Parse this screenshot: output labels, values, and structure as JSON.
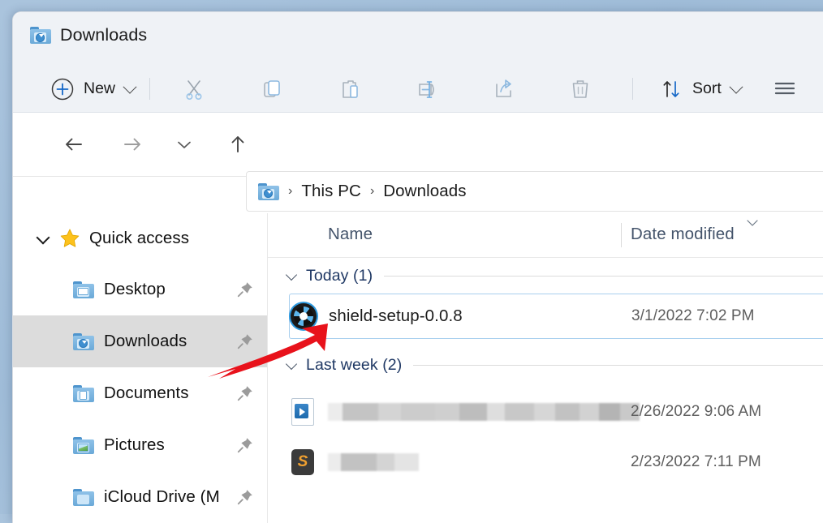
{
  "window": {
    "title": "Downloads",
    "title_icon": "downloads-folder-icon"
  },
  "toolbar": {
    "new_label": "New",
    "new_icon": "plus-circle-icon",
    "cut_icon": "scissors-icon",
    "copy_icon": "copy-icon",
    "paste_icon": "paste-icon",
    "rename_icon": "rename-icon",
    "share_icon": "share-icon",
    "delete_icon": "trash-icon",
    "sort_label": "Sort",
    "sort_icon": "sort-arrows-icon",
    "view_icon": "hamburger-menu-icon"
  },
  "nav": {
    "back_icon": "arrow-left-icon",
    "forward_icon": "arrow-right-icon",
    "recent_icon": "chevron-down-icon",
    "up_icon": "arrow-up-icon",
    "breadcrumb": {
      "icon": "downloads-folder-icon",
      "separator": "›",
      "items": [
        "This PC",
        "Downloads"
      ]
    }
  },
  "sidebar": {
    "items": [
      {
        "label": "Quick access",
        "icon": "star-icon",
        "type": "group",
        "expanded": true,
        "pinned": false,
        "selected": false
      },
      {
        "label": "Desktop",
        "icon": "desktop-folder-icon",
        "type": "item",
        "pinned": true,
        "selected": false
      },
      {
        "label": "Downloads",
        "icon": "downloads-folder-icon",
        "type": "item",
        "pinned": true,
        "selected": true
      },
      {
        "label": "Documents",
        "icon": "documents-folder-icon",
        "type": "item",
        "pinned": true,
        "selected": false
      },
      {
        "label": "Pictures",
        "icon": "pictures-folder-icon",
        "type": "item",
        "pinned": true,
        "selected": false
      },
      {
        "label": "iCloud Drive (M",
        "icon": "folder-icon",
        "type": "item",
        "pinned": true,
        "selected": false
      }
    ]
  },
  "file_list": {
    "columns": {
      "name": "Name",
      "date_modified": "Date modified",
      "sort_indicator_icon": "chevron-up-sort-icon"
    },
    "groups": [
      {
        "label": "Today (1)",
        "expanded": true,
        "rows": [
          {
            "name": "shield-setup-0.0.8",
            "date": "3/1/2022 7:02 PM",
            "icon": "shield-app-icon",
            "selected": true,
            "redacted": false
          }
        ]
      },
      {
        "label": "Last week (2)",
        "expanded": true,
        "rows": [
          {
            "name": "",
            "date": "2/26/2022 9:06 AM",
            "icon": "video-file-icon",
            "selected": false,
            "redacted": true
          },
          {
            "name": "",
            "date": "2/23/2022 7:11 PM",
            "icon": "sublime-app-icon",
            "selected": false,
            "redacted": true
          }
        ]
      }
    ]
  },
  "annotation": {
    "arrow_icon": "red-arrow-annotation",
    "color": "#e8121b"
  },
  "colors": {
    "titlebar_bg": "#eff2f6",
    "accent_blue": "#0f6cbd",
    "group_header_text": "#1f3864",
    "column_header_text": "#44546b",
    "selected_row_border": "#a8cfee",
    "sidebar_selected_bg": "#dcdcdc",
    "desktop_bg": "#a8c2dc"
  }
}
